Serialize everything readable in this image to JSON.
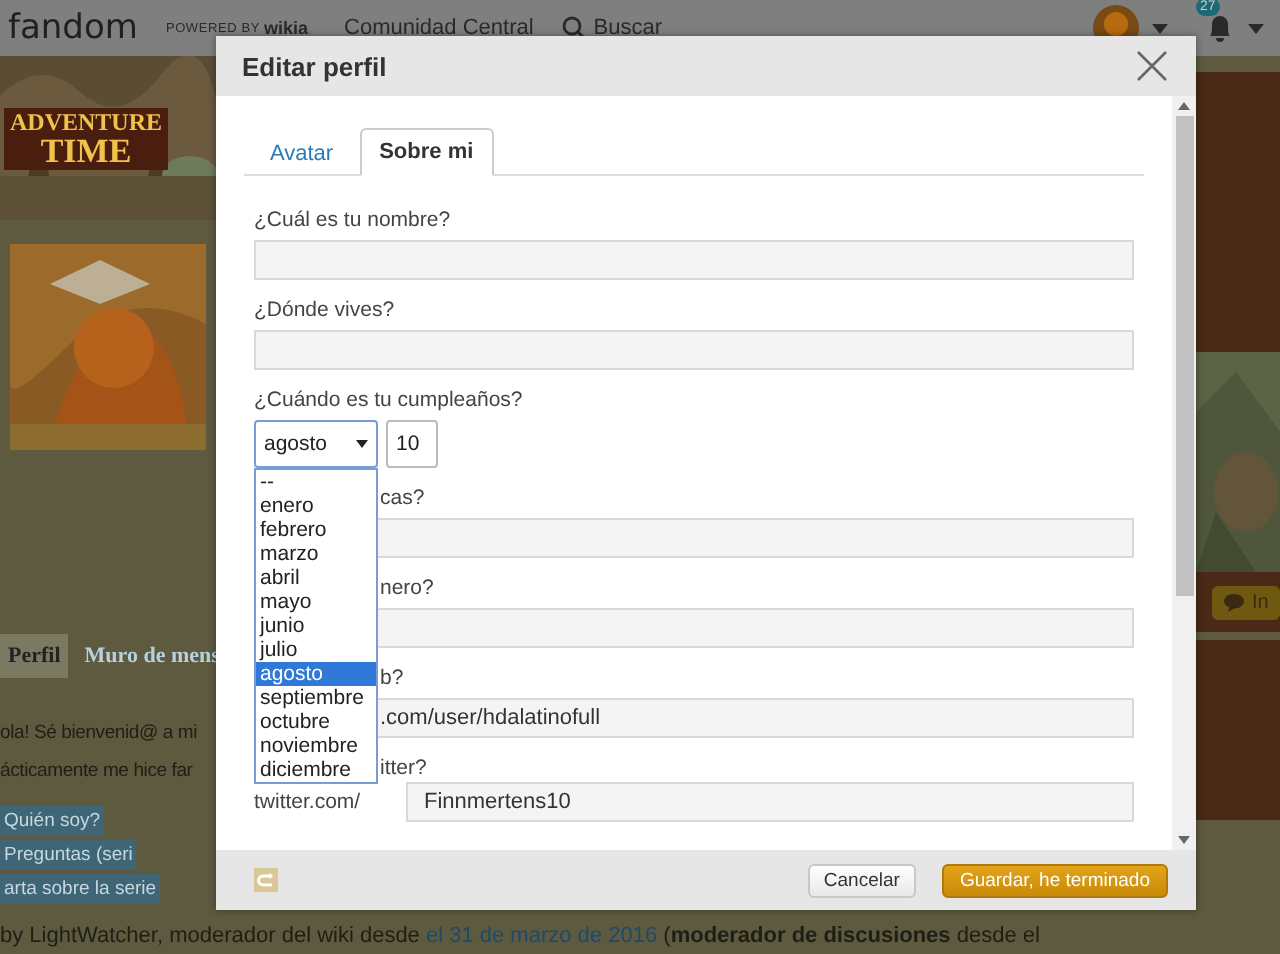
{
  "topbar": {
    "logo": "fandom",
    "powered_by": "POWERED BY",
    "wikia": "wikia",
    "community": "Comunidad Central",
    "search": "Buscar",
    "notifications": "27"
  },
  "wiki_logo": [
    "ADVENTURE",
    "TIME"
  ],
  "profile_tabs": [
    {
      "label": "Perfil",
      "selected": true
    },
    {
      "label": "Muro de mens",
      "selected": false
    }
  ],
  "intro_lines": [
    "ola! Sé bienvenid@ a mi",
    "ácticamente me hice far"
  ],
  "section_buttons": [
    "Quién soy?",
    "Preguntas (seri",
    "arta sobre la serie"
  ],
  "credit": {
    "before": "by LightWatcher, moderador del wiki desde ",
    "link": "el 31 de marzo de 2016",
    "after": " (**moderador de discusiones** desde el"
  },
  "side_button": "In",
  "dialog": {
    "title": "Editar perfil",
    "tabs": [
      {
        "label": "Avatar",
        "selected": false
      },
      {
        "label": "Sobre mi",
        "selected": true
      }
    ],
    "fields": [
      {
        "kind": "text",
        "label": "¿Cuál es tu nombre?"
      },
      {
        "kind": "text",
        "label": "¿Dónde vives?"
      },
      {
        "kind": "date",
        "label": "¿Cuándo es tu cumpleaños?",
        "month": "agosto",
        "day": "10",
        "expanded": true
      },
      {
        "kind": "text",
        "label": "cas?"
      },
      {
        "kind": "text",
        "label": "nero?"
      },
      {
        "kind": "text",
        "label": "b?",
        "value": ".com/user/hdalatinofull"
      },
      {
        "kind": "prefixed",
        "label": "itter?",
        "prefix": "twitter.com/",
        "value": "Finnmertens10"
      }
    ],
    "month_options": [
      {
        "label": "--",
        "selected": false
      },
      {
        "label": "enero",
        "selected": false
      },
      {
        "label": "febrero",
        "selected": false
      },
      {
        "label": "marzo",
        "selected": false
      },
      {
        "label": "abril",
        "selected": false
      },
      {
        "label": "mayo",
        "selected": false
      },
      {
        "label": "junio",
        "selected": false
      },
      {
        "label": "julio",
        "selected": false
      },
      {
        "label": "agosto",
        "selected": true
      },
      {
        "label": "septiembre",
        "selected": false
      },
      {
        "label": "octubre",
        "selected": false
      },
      {
        "label": "noviembre",
        "selected": false
      },
      {
        "label": "diciembre",
        "selected": false
      }
    ],
    "cancel": "Cancelar",
    "save": "Guardar, he terminado"
  }
}
